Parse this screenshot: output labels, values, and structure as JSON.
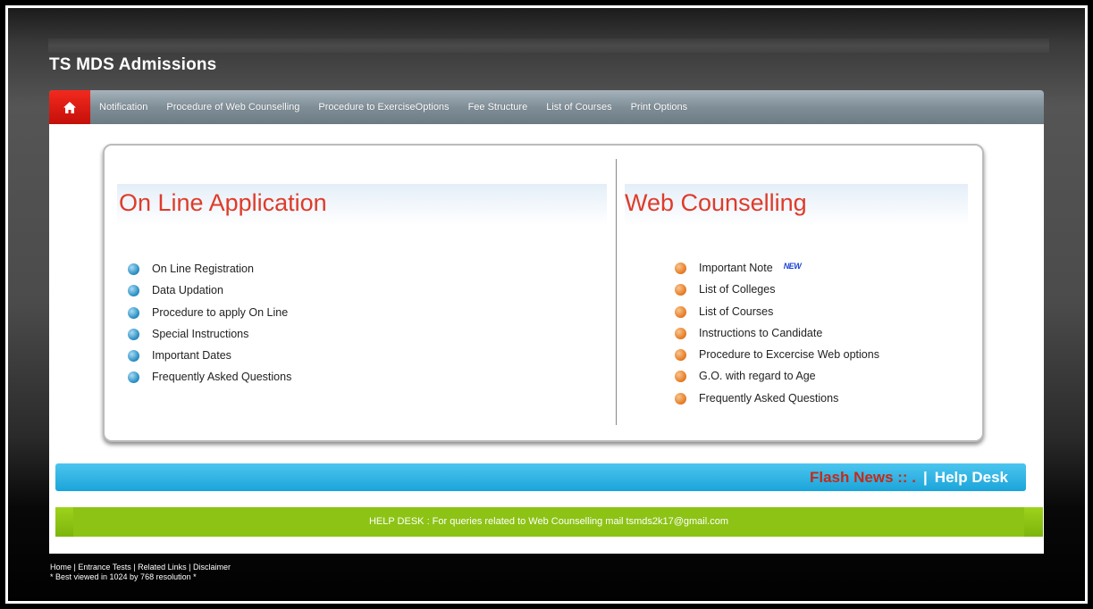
{
  "site": {
    "title": "TS MDS Admissions"
  },
  "nav": {
    "home_icon": "home-icon",
    "items": [
      "Notification",
      "Procedure of Web Counselling",
      "Procedure to ExerciseOptions",
      "Fee Structure",
      "List of Courses",
      "Print Options"
    ]
  },
  "online_application": {
    "heading": "On Line Application",
    "items": [
      "On Line Registration",
      "Data Updation",
      "Procedure to apply On Line",
      "Special Instructions",
      "Important Dates",
      "Frequently Asked Questions"
    ]
  },
  "web_counselling": {
    "heading": "Web Counselling",
    "new_badge": "NEW",
    "items": [
      "Important Note",
      "List of Colleges",
      "List of Courses",
      "Instructions to Candidate",
      "Procedure to Excercise Web options",
      "G.O. with regard to Age",
      "Frequently Asked Questions"
    ]
  },
  "flash": {
    "label": "Flash News :: .",
    "separator": "|",
    "helpdesk": "Help Desk"
  },
  "helpdesk_bar": {
    "text": "HELP DESK : For queries related to Web Counselling mail tsmds2k17@gmail.com"
  },
  "footer": {
    "links": [
      "Home",
      "Entrance Tests",
      "Related Links",
      "Disclaimer"
    ],
    "separator": " | ",
    "note": "* Best viewed in 1024 by 768 resolution *"
  },
  "colors": {
    "heading_red": "#df3b2a",
    "home_red": "#e41c12",
    "flash_blue": "#1ba4da",
    "help_green": "#8cc315",
    "bullet_blue": "#2a8fc4",
    "bullet_orange": "#e77d26"
  }
}
